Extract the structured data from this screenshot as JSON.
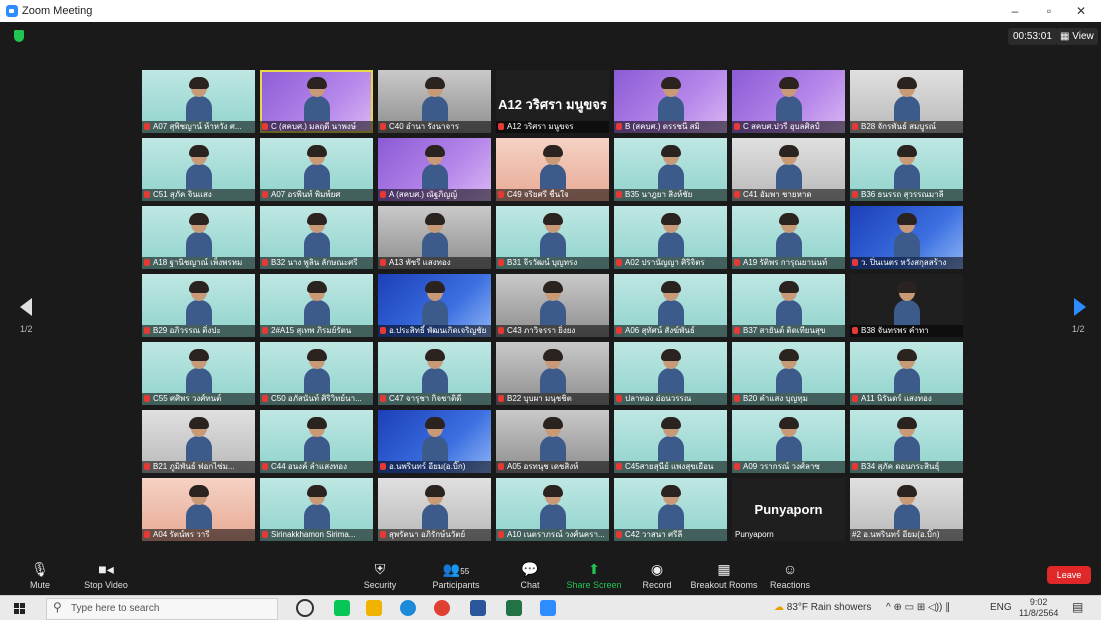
{
  "window": {
    "title": "Zoom Meeting",
    "controls": [
      "–",
      "▫",
      "✕"
    ]
  },
  "header": {
    "timer": "00:53:01",
    "view_label": "View",
    "page_left": "1/2",
    "page_right": "1/2"
  },
  "tiles": [
    {
      "name": "A07 สุพิชญาน์ ห้าหวัง ศ...",
      "style": "teal",
      "muted": true
    },
    {
      "name": "C (สคบศ.) มลฤดี นาพงษ์",
      "style": "purple",
      "muted": true,
      "selected": true
    },
    {
      "name": "C40 อำนา รังนาจาร",
      "style": "office",
      "muted": true
    },
    {
      "name": "A12 วริศรา มนูขจร",
      "style": "dark",
      "muted": true,
      "big": "A12 วริศรา มนูขจร"
    },
    {
      "name": "B (สคบศ.) ดรรชนี สมิ",
      "style": "purple",
      "muted": true
    },
    {
      "name": "C สคบศ.ปวรี อุบลศิลป์",
      "style": "purple",
      "muted": true
    },
    {
      "name": "B28 จักรพันธ์ สมบูรณ์",
      "style": "gray",
      "muted": true
    },
    {
      "name": "C51 สุภัค จินแสง",
      "style": "teal",
      "muted": true
    },
    {
      "name": "A07 อรพินท์ พิมพ์ยศ",
      "style": "teal",
      "muted": true
    },
    {
      "name": "A (สคบศ.) ณัฐภิญญ์",
      "style": "purple",
      "muted": true
    },
    {
      "name": "C49 จริยศรี ชื่นใจ",
      "style": "warm",
      "muted": true
    },
    {
      "name": "B35 นาฎยา สิงห์ชัย",
      "style": "teal",
      "muted": true
    },
    {
      "name": "C41 อัมพา ชายหาด",
      "style": "gray",
      "muted": true
    },
    {
      "name": "B36 ธนรรถ สุวรรณมาลี",
      "style": "teal",
      "muted": true
    },
    {
      "name": "A18 ฐานิชญาณ์ เพ็งพรหม",
      "style": "teal",
      "muted": true
    },
    {
      "name": "B32 นาง พูลิน ลักษณะศรี",
      "style": "teal",
      "muted": true
    },
    {
      "name": "A13 พัชรี แสงทอง",
      "style": "office",
      "muted": true
    },
    {
      "name": "B31 จีรวัฒน์ บุญทรง",
      "style": "teal",
      "muted": true
    },
    {
      "name": "A02 ปรานัญญา ศิริจิตร",
      "style": "teal",
      "muted": true
    },
    {
      "name": "A19 รัติพร การุณยานนท์",
      "style": "teal",
      "muted": true
    },
    {
      "name": "ว. ปิ่นเนตร หวังสกุลสร้าง",
      "style": "blue",
      "muted": true
    },
    {
      "name": "B29 อภิวรรณ ติ่งปะ",
      "style": "teal",
      "muted": true
    },
    {
      "name": "2#A15 สุเทพ ภิรมย์รัตน",
      "style": "teal",
      "muted": true
    },
    {
      "name": "อ.ประสิทธิ์ พัฒนเกิดเจริญชัย",
      "style": "blue",
      "muted": true
    },
    {
      "name": "C43 ภาวิจรรา ยิ่งยง",
      "style": "office",
      "muted": true
    },
    {
      "name": "A06 สุทัศน์ สังฆ์พันธ์",
      "style": "teal",
      "muted": true
    },
    {
      "name": "B37 สายันต์ ติดเทียนสุข",
      "style": "teal",
      "muted": true
    },
    {
      "name": "B38 จันทรพร คำทา",
      "style": "dark",
      "muted": true
    },
    {
      "name": "C55 ศศิพร วงศ์ทนต์",
      "style": "teal",
      "muted": true
    },
    {
      "name": "C50 อภัสนันท์ ศิริวิทย์นา...",
      "style": "teal",
      "muted": true
    },
    {
      "name": "C47 จารุชา กิจชาติดี",
      "style": "teal",
      "muted": true
    },
    {
      "name": "B22 บุบผา มนุชชิต",
      "style": "office",
      "muted": true
    },
    {
      "name": "ปลาทอง อ่อนวรรณ",
      "style": "teal",
      "muted": true
    },
    {
      "name": "B20 คำแสง บุญทุม",
      "style": "teal",
      "muted": true
    },
    {
      "name": "A11 นิรันดร์ แสงทอง",
      "style": "teal",
      "muted": true
    },
    {
      "name": "B21 ภูมิพันธ์ ฟอกไซ่ม...",
      "style": "gray",
      "muted": true
    },
    {
      "name": "C44 อนงค์ ลำแสงทอง",
      "style": "teal",
      "muted": true
    },
    {
      "name": "อ.นพรินทร์ อียม(อ.บิ๊ก)",
      "style": "blue",
      "muted": true
    },
    {
      "name": "A05 อรทนุช เดชสิงห์",
      "style": "office",
      "muted": true
    },
    {
      "name": "C45สายสุนีย์ แพงสุขเยือน",
      "style": "teal",
      "muted": true
    },
    {
      "name": "A09 วรากรณ์ วงศ์ลาซ",
      "style": "teal",
      "muted": true
    },
    {
      "name": "B34 สุภัค ดอนกระสินธุ์",
      "style": "teal",
      "muted": true
    },
    {
      "name": "A04 รัตน์พร วารี",
      "style": "warm",
      "muted": true
    },
    {
      "name": "Sirinakkhamon Sirima...",
      "style": "teal",
      "muted": true
    },
    {
      "name": "สุพรัตนา อภิรักษ์นวัตย์",
      "style": "gray",
      "muted": true
    },
    {
      "name": "A10 เนตราภรณ์ วงศ์นครา...",
      "style": "teal",
      "muted": true
    },
    {
      "name": "C42 วาสนา ศรีลี",
      "style": "teal",
      "muted": true
    },
    {
      "name": "Punyaporn",
      "style": "dark",
      "muted": false,
      "big": "Punyaporn",
      "plain": true
    },
    {
      "name": "#2 อ.นพรินทร์ อียม(อ.บิ๊ก)",
      "style": "gray",
      "muted": false
    }
  ],
  "toolbar": {
    "mute": "Mute",
    "stop_video": "Stop Video",
    "security": "Security",
    "participants": "Participants",
    "participants_count": "55",
    "chat": "Chat",
    "chat_badge": "1",
    "share_screen": "Share Screen",
    "record": "Record",
    "breakout_rooms": "Breakout Rooms",
    "reactions": "Reactions",
    "leave": "Leave"
  },
  "taskbar": {
    "search_placeholder": "Type here to search",
    "weather": "83°F  Rain showers",
    "lang": "ENG",
    "time": "9:02",
    "date": "11/8/2564"
  }
}
